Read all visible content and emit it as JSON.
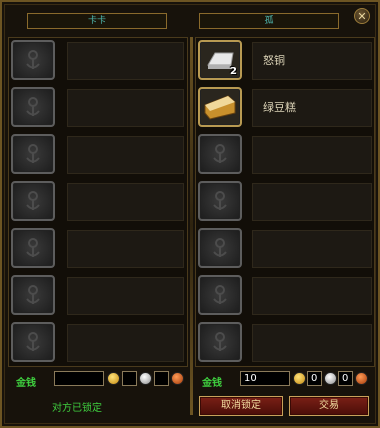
{
  "left_panel": {
    "player_name": "卡卡",
    "slots": [
      {},
      {},
      {},
      {},
      {},
      {},
      {}
    ],
    "money_label": "金钱",
    "gold": "",
    "silver": "",
    "copper": "",
    "status_text": "对方已锁定"
  },
  "right_panel": {
    "player_name": "孤",
    "slots": [
      {
        "item_name": "怒铜",
        "icon": "silver-ingot-icon",
        "quantity": "2"
      },
      {
        "item_name": "绿豆糕",
        "icon": "mung-bean-cake-icon",
        "quantity": ""
      },
      {},
      {},
      {},
      {},
      {}
    ],
    "money_label": "金钱",
    "gold": "10",
    "silver": "0",
    "copper": "0",
    "cancel_lock_label": "取消锁定",
    "trade_label": "交易"
  },
  "colors": {
    "frame": "#6d5523",
    "name_text": "#4fb8b0",
    "money_label": "#3fcf3f",
    "button_bg": "#6a1a12"
  }
}
